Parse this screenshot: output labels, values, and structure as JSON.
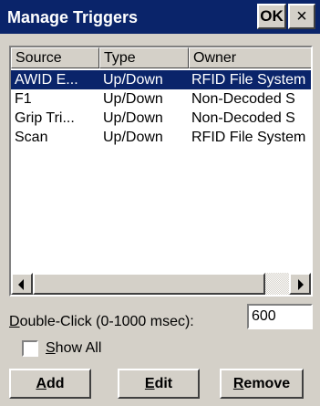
{
  "window": {
    "title": "Manage Triggers",
    "ok_label": "OK",
    "close_label": "×"
  },
  "list": {
    "columns": [
      "Source",
      "Type",
      "Owner"
    ],
    "rows": [
      {
        "source": "AWID E...",
        "type": "Up/Down",
        "owner": "RFID File System",
        "selected": true
      },
      {
        "source": "F1",
        "type": "Up/Down",
        "owner": "Non-Decoded S",
        "selected": false
      },
      {
        "source": "Grip Tri...",
        "type": "Up/Down",
        "owner": "Non-Decoded S",
        "selected": false
      },
      {
        "source": "Scan",
        "type": "Up/Down",
        "owner": "RFID File System",
        "selected": false
      }
    ]
  },
  "double_click": {
    "label_hotkey": "D",
    "label_rest": "ouble-Click (0-1000 msec):",
    "value": "600"
  },
  "show_all": {
    "label_hotkey": "S",
    "label_rest": "how All",
    "checked": false
  },
  "buttons": {
    "add": {
      "hotkey": "A",
      "rest": "dd"
    },
    "edit": {
      "hotkey": "E",
      "rest": "dit"
    },
    "remove": {
      "hotkey": "R",
      "rest": "emove"
    }
  },
  "colors": {
    "titlebar": "#0a246a",
    "selection": "#0a246a",
    "face": "#d4d0c8"
  }
}
